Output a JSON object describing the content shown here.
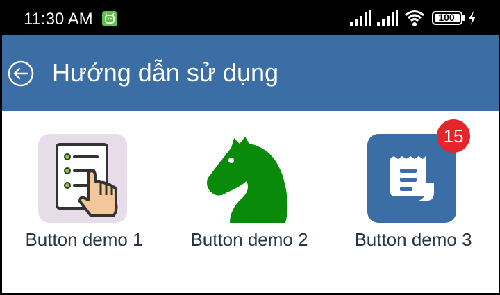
{
  "status_bar": {
    "time": "11:30 AM",
    "battery_level": "100",
    "icons": [
      "app-notification-icon",
      "signal-icon",
      "signal-icon",
      "wifi-icon",
      "battery-icon",
      "charging-bolt-icon"
    ]
  },
  "app_bar": {
    "title": "Hướng dẫn sử dụng",
    "back_icon": "back-circle-arrow-icon"
  },
  "tiles": [
    {
      "label": "Button demo 1",
      "icon": "checklist-hand-icon"
    },
    {
      "label": "Button demo 2",
      "icon": "chess-knight-icon"
    },
    {
      "label": "Button demo 3",
      "icon": "receipt-icon",
      "badge": "15"
    }
  ],
  "colors": {
    "app_bar": "#3b6ea5",
    "badge": "#e4262b",
    "knight": "#0a8a0a",
    "label_text": "#273747"
  }
}
